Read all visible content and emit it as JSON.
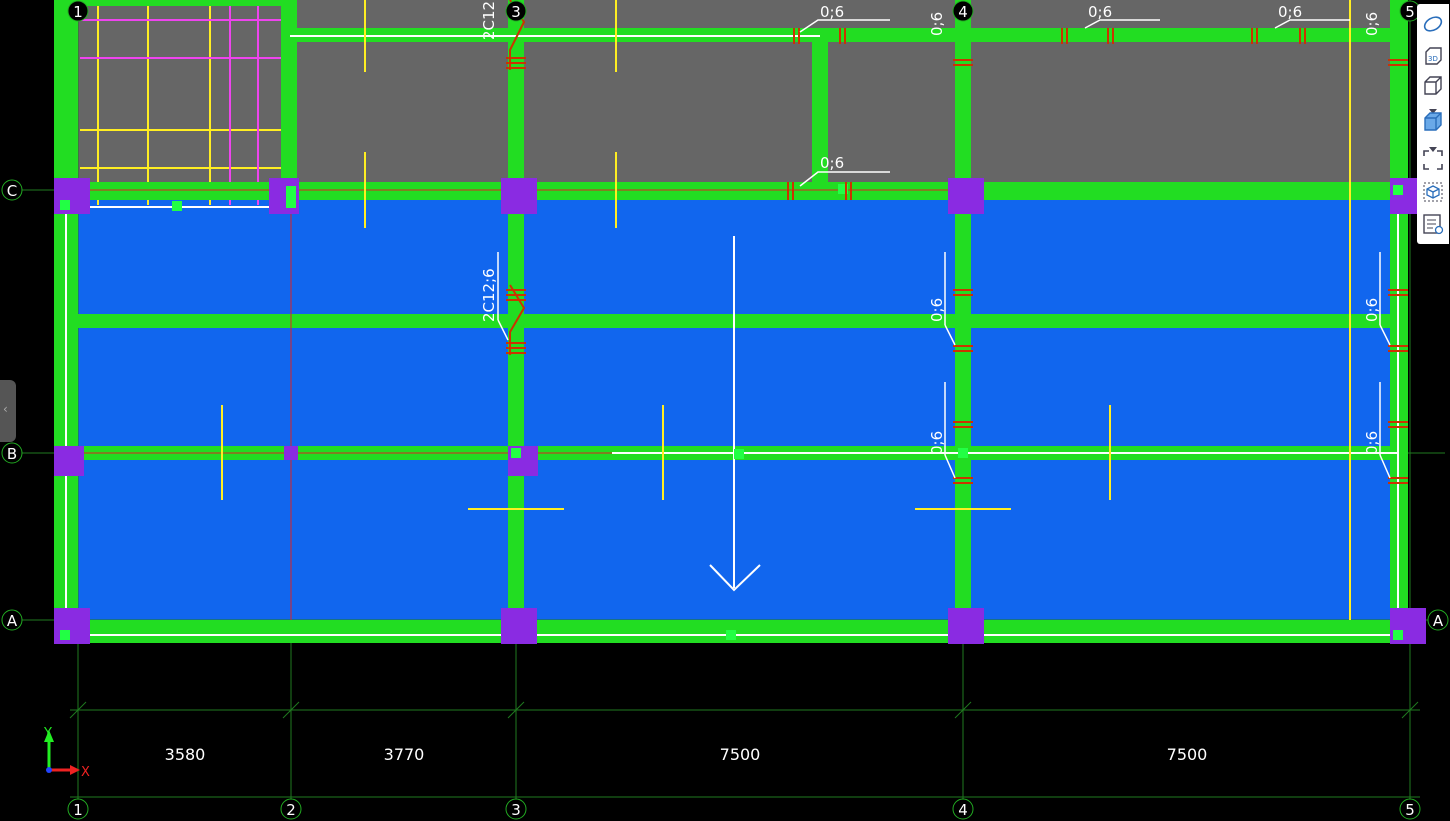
{
  "axes": {
    "columns": [
      {
        "id": "col-1",
        "label": "1"
      },
      {
        "id": "col-2",
        "label": "2"
      },
      {
        "id": "col-3",
        "label": "3"
      },
      {
        "id": "col-4",
        "label": "4"
      },
      {
        "id": "col-5",
        "label": "5"
      }
    ],
    "top_columns": [
      "1",
      "3",
      "4",
      "5"
    ],
    "rows": [
      {
        "id": "row-c",
        "label": "C"
      },
      {
        "id": "row-b",
        "label": "B"
      },
      {
        "id": "row-a",
        "label": "A"
      }
    ]
  },
  "dimensions": [
    "3580",
    "3770",
    "7500",
    "7500"
  ],
  "annotations": {
    "rebar_label": "0;6",
    "beam_label": "2C12;6"
  },
  "ucs": {
    "x_label": "X",
    "y_label": "Y"
  },
  "toolbar": {
    "items": [
      "shape-view-icon",
      "3d-view-icon",
      "box-view-icon",
      "shaded-box-icon",
      "zoom-extents-icon",
      "model-icon",
      "layers-icon"
    ]
  },
  "colors": {
    "background": "#000000",
    "beam": "#22dd22",
    "slab_blue": "#1166ee",
    "slab_gray": "#666666",
    "column": "#8a2be2",
    "grid": "#1f7a1f",
    "rebar": "#cc3300",
    "yellow": "#ffee22",
    "magenta": "#ee44ee"
  }
}
